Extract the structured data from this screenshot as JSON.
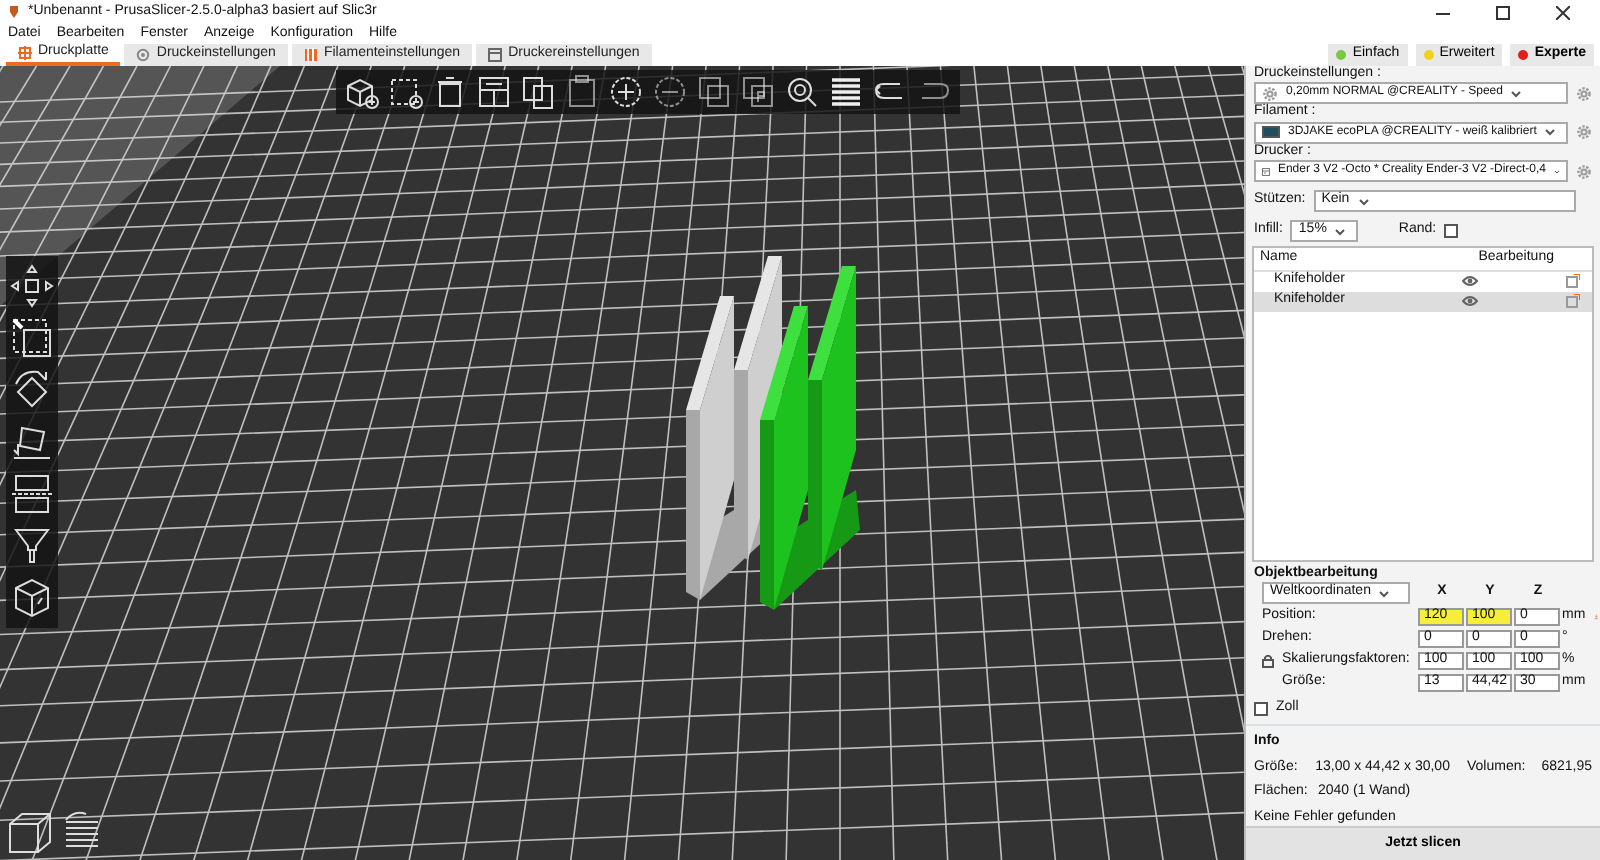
{
  "window": {
    "title": "*Unbenannt - PrusaSlicer-2.5.0-alpha3 basiert auf Slic3r"
  },
  "menu": [
    "Datei",
    "Bearbeiten",
    "Fenster",
    "Anzeige",
    "Konfiguration",
    "Hilfe"
  ],
  "tabs": [
    {
      "label": "Druckplatte",
      "kind": "plater",
      "selected": true
    },
    {
      "label": "Druckeinstellungen",
      "kind": "print",
      "selected": false
    },
    {
      "label": "Filamenteinstellungen",
      "kind": "filament",
      "selected": false
    },
    {
      "label": "Druckereinstellungen",
      "kind": "printer",
      "selected": false
    }
  ],
  "modes": [
    {
      "label": "Einfach",
      "color": "#7ac943",
      "selected": false
    },
    {
      "label": "Erweitert",
      "color": "#f2d31b",
      "selected": false
    },
    {
      "label": "Experte",
      "color": "#e0201b",
      "selected": true
    }
  ],
  "presets": [
    {
      "label": "Druckeinstellungen :",
      "value": "0,20mm NORMAL @CREALITY - Speed",
      "kind": "print"
    },
    {
      "label": "Filament :",
      "value": "3DJAKE ecoPLA @CREALITY - weiß kalibriert",
      "kind": "filament",
      "color": "#1f4f5c"
    },
    {
      "label": "Drucker :",
      "value": "Ender 3 V2 -Octo * Creality Ender-3 V2 -Direct-0,4",
      "kind": "printer"
    }
  ],
  "supports": {
    "label": "Stützen:",
    "value": "Kein"
  },
  "infill": {
    "label": "Infill:",
    "value": "15%"
  },
  "brim": {
    "label": "Rand:",
    "checked": false
  },
  "object_list": {
    "columns": [
      "Name",
      "Bearbeitung"
    ],
    "rows": [
      {
        "name": "Knifeholder",
        "selected": false
      },
      {
        "name": "Knifeholder",
        "selected": true
      }
    ]
  },
  "object_manipulation": {
    "title": "Objektbearbeitung",
    "coordinates": "Weltkoordinaten",
    "axes": [
      "X",
      "Y",
      "Z"
    ],
    "rows": [
      {
        "label": "Position:",
        "kind": "plain",
        "unit": "mm",
        "values": [
          {
            "text": "120",
            "modified": true
          },
          {
            "text": "100",
            "modified": true
          },
          {
            "text": "0",
            "modified": false
          }
        ]
      },
      {
        "label": "Drehen:",
        "kind": "plain",
        "unit": "°",
        "values": [
          {
            "text": "0",
            "modified": false
          },
          {
            "text": "0",
            "modified": false
          },
          {
            "text": "0",
            "modified": false
          }
        ]
      },
      {
        "label": "Skalierungsfaktoren:",
        "kind": "locked",
        "unit": "%",
        "values": [
          {
            "text": "100",
            "modified": false
          },
          {
            "text": "100",
            "modified": false
          },
          {
            "text": "100",
            "modified": false
          }
        ]
      },
      {
        "label": "Größe:",
        "kind": "locked",
        "unit": "mm",
        "values": [
          {
            "text": "13",
            "modified": false
          },
          {
            "text": "44,42",
            "modified": false
          },
          {
            "text": "30",
            "modified": false
          }
        ]
      }
    ],
    "inches": {
      "label": "Zoll",
      "checked": false
    }
  },
  "info": {
    "title": "Info",
    "size": {
      "label": "Größe:",
      "value": "13,00 x 44,42 x 30,00"
    },
    "volume": {
      "label": "Volumen:",
      "value": "6821,95"
    },
    "facets": {
      "label": "Flächen:",
      "value": "2040 (1 Wand)"
    },
    "status": "Keine Fehler gefunden"
  },
  "slice_button": "Jetzt slicen"
}
